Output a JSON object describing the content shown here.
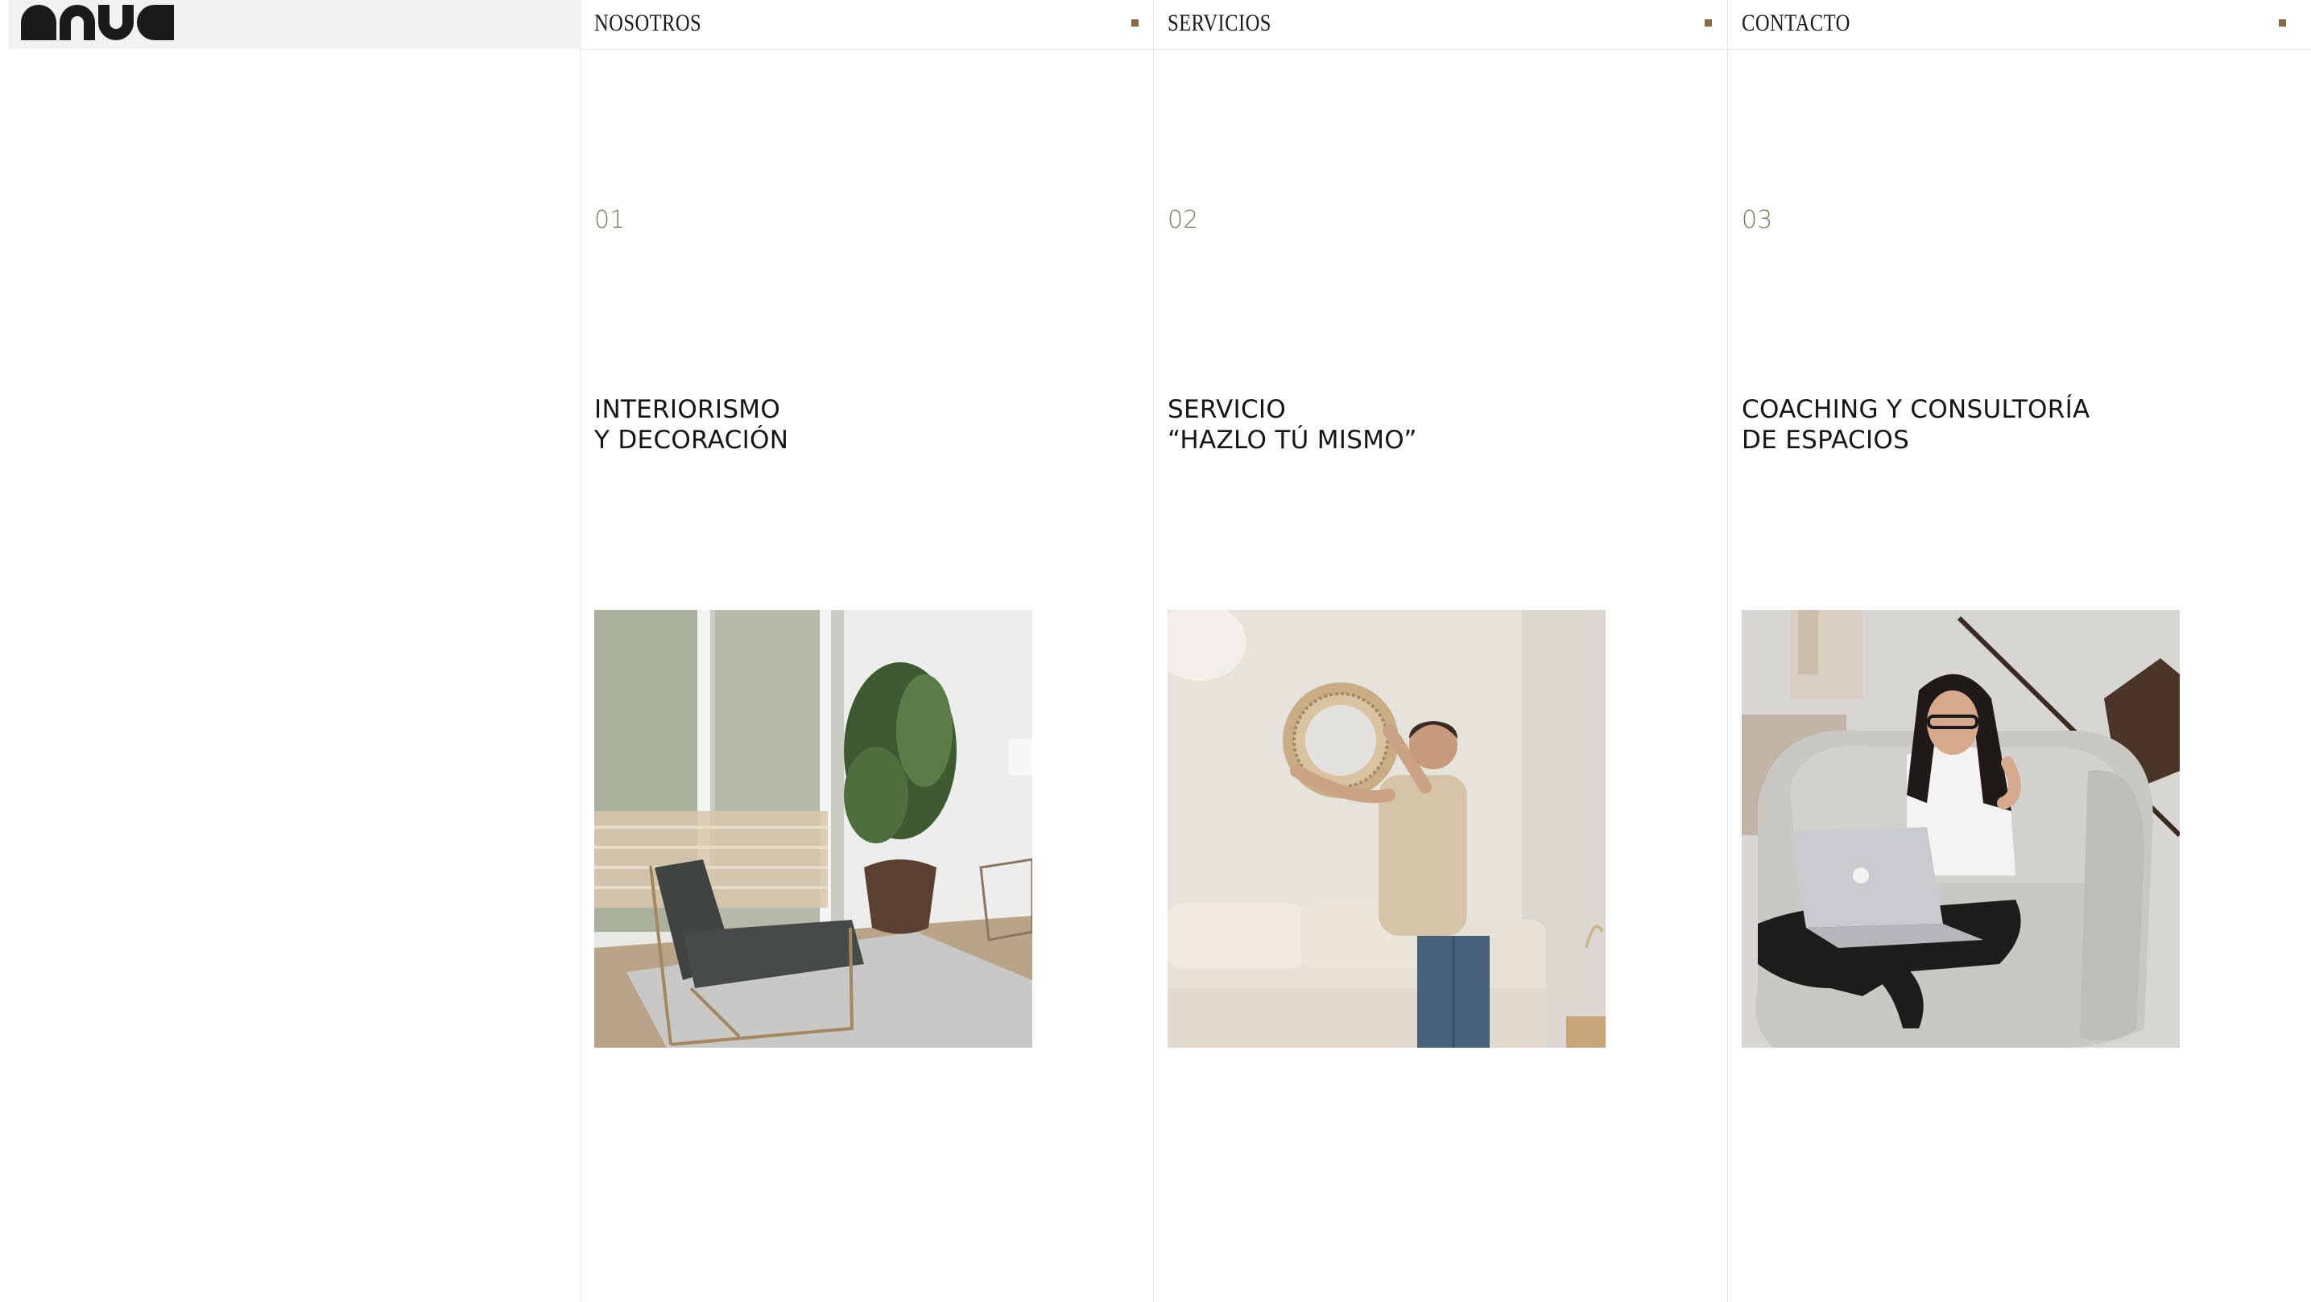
{
  "brand": {
    "logo_text": "anua"
  },
  "colors": {
    "accent_number": "#7b7a58",
    "nav_dot": "#8a6a42",
    "logo_bg": "#f2f2f0",
    "divider": "#e8e8e6"
  },
  "nav": [
    {
      "label": "NOSOTROS",
      "icon": "square-dot-icon"
    },
    {
      "label": "SERVICIOS",
      "icon": "square-dot-icon"
    },
    {
      "label": "CONTACTO",
      "icon": "square-dot-icon"
    }
  ],
  "services": [
    {
      "number": "01",
      "title_line1": "INTERIORISMO",
      "title_line2": "Y DECORACIÓN",
      "image": "living-room-armchair-plant-photo"
    },
    {
      "number": "02",
      "title_line1": "SERVICIO",
      "title_line2": "“HAZLO TÚ MISMO”",
      "image": "man-hanging-round-mirror-photo"
    },
    {
      "number": "03",
      "title_line1": "COACHING Y CONSULTORÍA",
      "title_line2": "DE ESPACIOS",
      "image": "woman-laptop-armchair-photo"
    }
  ]
}
